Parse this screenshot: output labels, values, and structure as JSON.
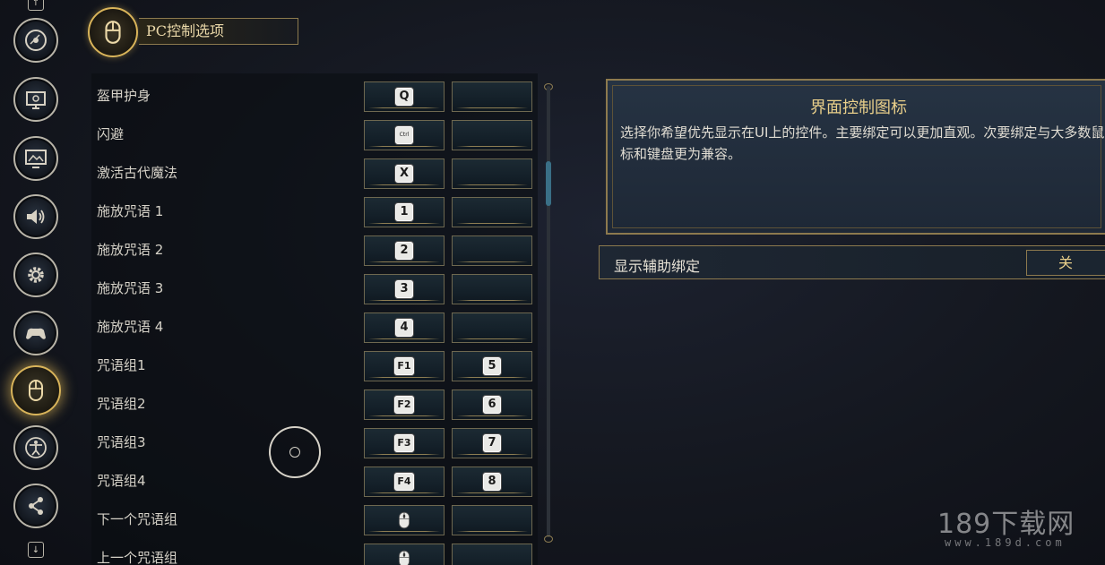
{
  "header": {
    "title": "PC控制选项",
    "icon": "mouse-icon"
  },
  "sidebar": {
    "items": [
      {
        "name": "disc-icon"
      },
      {
        "name": "display-icon"
      },
      {
        "name": "monitor-image-icon"
      },
      {
        "name": "speaker-icon"
      },
      {
        "name": "gear-icon"
      },
      {
        "name": "gamepad-icon"
      },
      {
        "name": "mouse-icon",
        "active": true
      },
      {
        "name": "accessibility-icon"
      },
      {
        "name": "share-icon"
      }
    ]
  },
  "bindings": [
    {
      "action": "盔甲护身",
      "primary": "Q",
      "secondary": ""
    },
    {
      "action": "闪避",
      "primary": "Ctrl",
      "secondary": ""
    },
    {
      "action": "激活古代魔法",
      "primary": "X",
      "secondary": ""
    },
    {
      "action": "施放咒语 1",
      "primary": "1",
      "secondary": ""
    },
    {
      "action": "施放咒语 2",
      "primary": "2",
      "secondary": ""
    },
    {
      "action": "施放咒语 3",
      "primary": "3",
      "secondary": ""
    },
    {
      "action": "施放咒语 4",
      "primary": "4",
      "secondary": ""
    },
    {
      "action": "咒语组1",
      "primary": "F1",
      "secondary": "5"
    },
    {
      "action": "咒语组2",
      "primary": "F2",
      "secondary": "6"
    },
    {
      "action": "咒语组3",
      "primary": "F3",
      "secondary": "7"
    },
    {
      "action": "咒语组4",
      "primary": "F4",
      "secondary": "8"
    },
    {
      "action": "下一个咒语组",
      "primary": "mouse",
      "secondary": ""
    },
    {
      "action": "上一个咒语组",
      "primary": "mouse",
      "secondary": ""
    }
  ],
  "info": {
    "title": "界面控制图标",
    "text": "选择你希望优先显示在UI上的控件。主要绑定可以更加直观。次要绑定与大多数鼠标和键盘更为兼容。"
  },
  "toggle": {
    "label": "显示辅助绑定",
    "value": "关"
  },
  "watermark": {
    "main": "189下载网",
    "sub": "www.189d.com"
  },
  "colors": {
    "accent_gold": "#d9b45a",
    "panel_bg": "#263343",
    "key_bg": "#e9e9e6"
  }
}
